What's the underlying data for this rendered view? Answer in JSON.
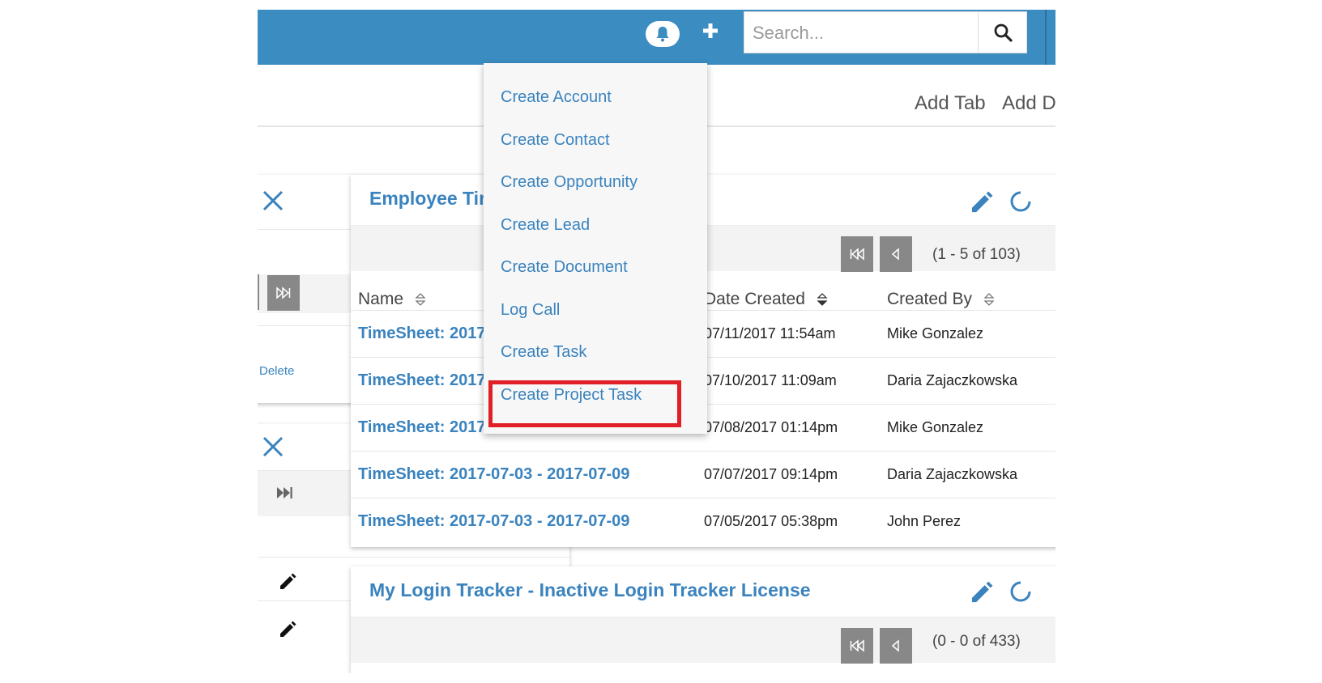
{
  "header": {
    "search_placeholder": "Search...",
    "add_tab_label": "Add Tab",
    "add_dashlet_label": "Add D"
  },
  "create_menu": {
    "items": [
      {
        "label": "Create Account"
      },
      {
        "label": "Create Contact"
      },
      {
        "label": "Create Opportunity"
      },
      {
        "label": "Create Lead"
      },
      {
        "label": "Create Document"
      },
      {
        "label": "Log Call"
      },
      {
        "label": "Create Task"
      },
      {
        "label": "Create Project Task"
      }
    ],
    "highlighted": "Create Project Task"
  },
  "left_dashlets": {
    "delete_label": "Delete"
  },
  "timesheet_dashlet": {
    "title": "Employee Tir",
    "pagination": "(1 - 5 of 103)",
    "columns": [
      "Name",
      "Date Created",
      "Created By"
    ],
    "rows": [
      {
        "name": "TimeSheet: 2017",
        "date": "07/11/2017 11:54am",
        "by": "Mike Gonzalez"
      },
      {
        "name": "TimeSheet: 2017",
        "date": "07/10/2017 11:09am",
        "by": "Daria Zajaczkowska"
      },
      {
        "name": "TimeSheet: 2017",
        "date": "07/08/2017 01:14pm",
        "by": "Mike Gonzalez"
      },
      {
        "name": "TimeSheet: 2017-07-03 - 2017-07-09",
        "date": "07/07/2017 09:14pm",
        "by": "Daria Zajaczkowska"
      },
      {
        "name": "TimeSheet: 2017-07-03 - 2017-07-09",
        "date": "07/05/2017 05:38pm",
        "by": "John Perez"
      }
    ]
  },
  "login_dashlet": {
    "title": "My Login Tracker - Inactive Login Tracker License",
    "pagination": "(0 - 0 of 433)"
  },
  "colors": {
    "header_bg": "#3b8cc1",
    "link": "#3a83be",
    "highlight_border": "#e01f26"
  },
  "icons": [
    "bell-icon",
    "plus-icon",
    "search-icon",
    "close-icon",
    "pencil-icon",
    "refresh-icon",
    "first-page-icon",
    "prev-page-icon",
    "last-page-icon",
    "sort-icon"
  ]
}
